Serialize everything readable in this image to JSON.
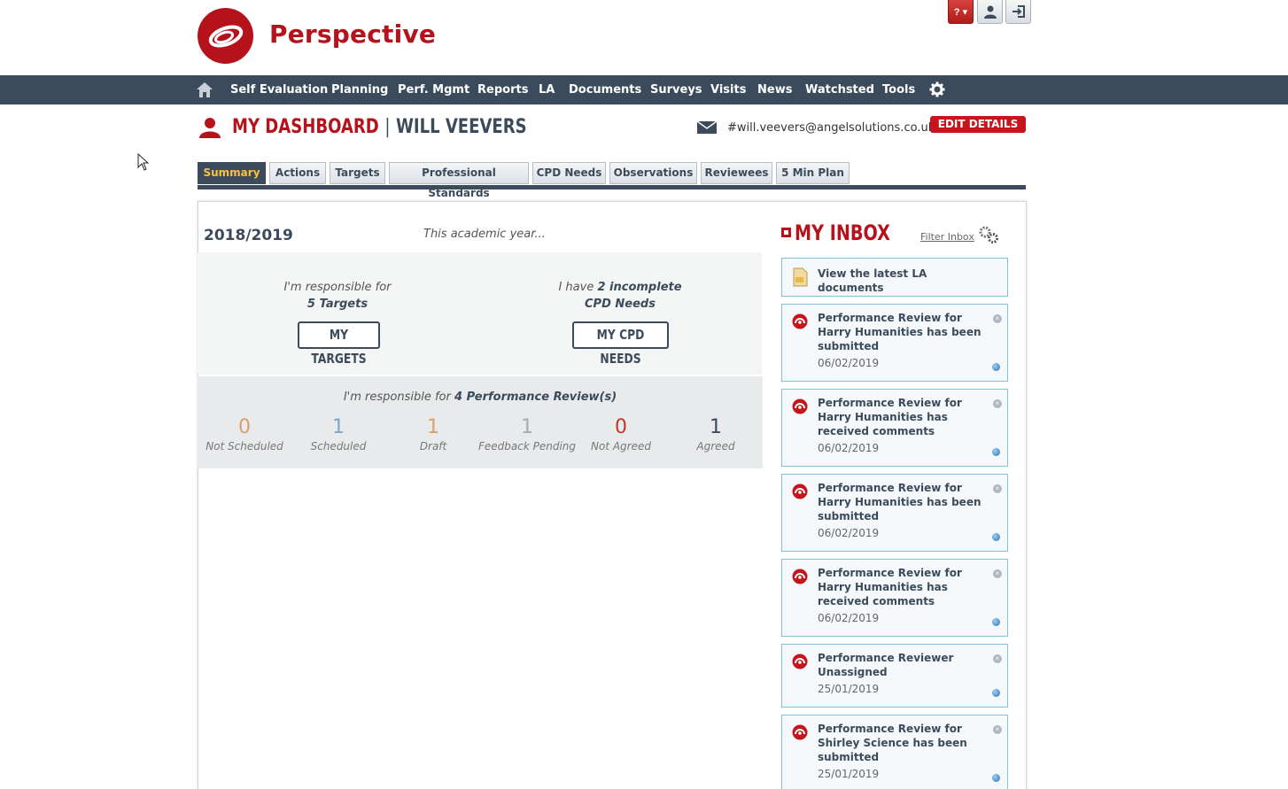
{
  "app": {
    "brand": "Perspective"
  },
  "top_buttons": {
    "help_label": "? ▾"
  },
  "nav": {
    "items": [
      "Self Evaluation",
      "Planning",
      "Perf. Mgmt",
      "Reports",
      "LA",
      "Documents",
      "Surveys",
      "Visits",
      "News",
      "Watchsted",
      "Tools"
    ]
  },
  "dashboard": {
    "title": "MY DASHBOARD",
    "separator": "|",
    "user_name": "WILL VEEVERS",
    "email": "#will.veevers@angelsolutions.co.uk",
    "edit_button": "EDIT DETAILS"
  },
  "tabs": [
    "Summary",
    "Actions",
    "Targets",
    "Professional Standards",
    "CPD Needs",
    "Observations",
    "Reviewees",
    "5 Min Plan"
  ],
  "summary": {
    "year": "2018/2019",
    "year_sub": "This academic year...",
    "targets_line1": "I'm responsible for",
    "targets_line2": "5 Targets",
    "targets_button": "MY TARGETS",
    "cpd_line1_pre": "I have",
    "cpd_line1_bold": "2 incomplete",
    "cpd_line2": "CPD Needs",
    "cpd_button": "MY CPD NEEDS",
    "pr_pre": "I'm responsible for",
    "pr_bold": "4 Performance Review(s)",
    "stats": [
      {
        "value": "0",
        "label": "Not Scheduled",
        "color": "#d9a06a"
      },
      {
        "value": "1",
        "label": "Scheduled",
        "color": "#7ea6c8"
      },
      {
        "value": "1",
        "label": "Draft",
        "color": "#d9a06a"
      },
      {
        "value": "1",
        "label": "Feedback Pending",
        "color": "#a8acb0"
      },
      {
        "value": "0",
        "label": "Not Agreed",
        "color": "#c0392b"
      },
      {
        "value": "1",
        "label": "Agreed",
        "color": "#3b4b5c"
      }
    ]
  },
  "inbox": {
    "title": "MY INBOX",
    "filter_label": "Filter Inbox",
    "la_docs": "View the latest LA documents",
    "messages": [
      {
        "text": "Performance Review for Harry Humanities has been submitted",
        "date": "06/02/2019"
      },
      {
        "text": "Performance Review for Harry Humanities has received comments",
        "date": "06/02/2019"
      },
      {
        "text": "Performance Review for Harry Humanities has been submitted",
        "date": "06/02/2019"
      },
      {
        "text": "Performance Review for Harry Humanities has received comments",
        "date": "06/02/2019"
      },
      {
        "text": "Performance Reviewer Unassigned",
        "date": "25/01/2019"
      },
      {
        "text": "Performance Review for Shirley Science has been submitted",
        "date": "25/01/2019"
      }
    ]
  },
  "colors": {
    "brand_red": "#b5121b",
    "nav_bg": "#3b4b5c",
    "tab_active_text": "#f6c241",
    "inbox_border": "#7fc1d8"
  }
}
